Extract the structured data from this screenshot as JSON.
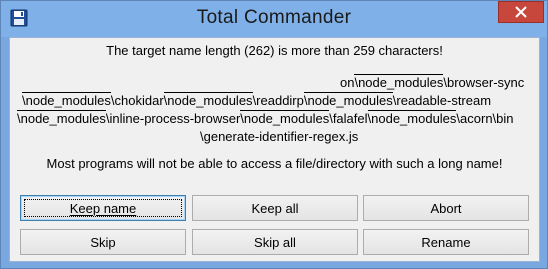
{
  "window": {
    "title": "Total Commander"
  },
  "message": {
    "line1": "The target name length (262) is more than 259 characters!",
    "path": [
      [
        "on",
        "\\node_modules",
        "\\browser-sync"
      ],
      [
        "\\node_modules",
        "\\chokidar",
        "\\node_modules",
        "\\readdirp",
        "\\node_modules",
        "\\readable-stream"
      ],
      [
        "\\node_modules",
        "\\inline-process-browser",
        "\\node_modules",
        "\\falafel",
        "\\node_modules",
        "\\acorn\\bin"
      ],
      [
        "\\generate-identifier-regex.js"
      ]
    ],
    "line_last": "Most programs will not be able to access a file/directory with such a long name!"
  },
  "buttons": {
    "keep_name": "Keep name",
    "keep_all": "Keep all",
    "abort": "Abort",
    "skip": "Skip",
    "skip_all": "Skip all",
    "rename": "Rename"
  },
  "icons": {
    "app": "floppy-disk-icon",
    "close": "close-icon"
  },
  "colors": {
    "titlebar": "#7fb0e8",
    "close": "#c7473c"
  }
}
